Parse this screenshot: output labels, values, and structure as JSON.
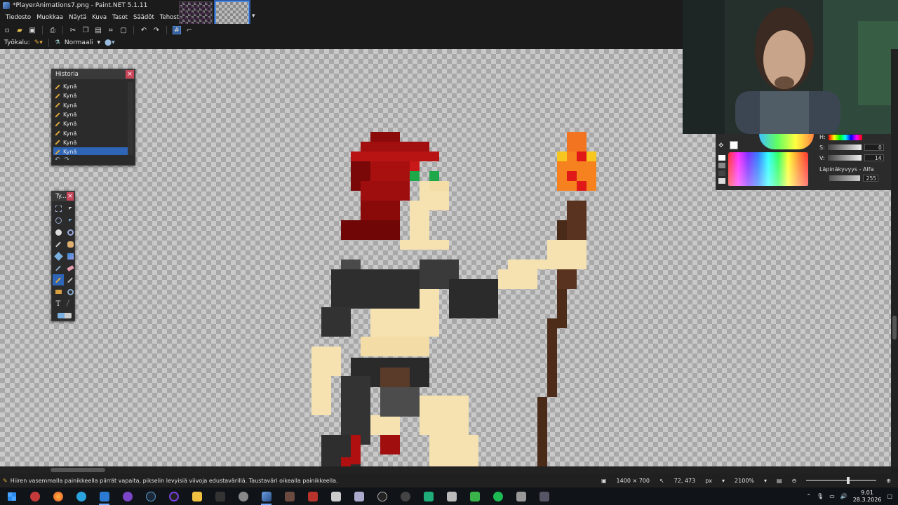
{
  "window": {
    "title": "*PlayerAnimations7.png - Paint.NET 5.1.11"
  },
  "menu": [
    "Tiedosto",
    "Muokkaa",
    "Näytä",
    "Kuva",
    "Tasot",
    "Säädöt",
    "Tehosteet"
  ],
  "tool_options": {
    "tool_label": "Työkalu:",
    "blend_mode": "Normaali"
  },
  "history": {
    "title": "Historia",
    "items": [
      "Kynä",
      "Kynä",
      "Kynä",
      "Kynä",
      "Kynä",
      "Kynä",
      "Kynä",
      "Kynä"
    ],
    "selected_index": 7
  },
  "tools_panel": {
    "title": "Ty..."
  },
  "colors": {
    "h_label": "H:",
    "s_label": "S:",
    "v_label": "V:",
    "s_value": "0",
    "v_value": "14",
    "alpha_label": "Läpinäkyvyys - Alfa",
    "alpha_value": "255",
    "primary": "#1a1a1a"
  },
  "status": {
    "hint": "Hiiren vasemmalla painikkeella piirrät vapaita, pikselin levyisiä viivoja edustavärillä. Taustaväri oikealla painikkeella.",
    "image_size": "1400 × 700",
    "cursor_pos": "72, 473",
    "unit": "px",
    "zoom": "2100%"
  },
  "clock": {
    "time": "9.01",
    "date": "28.3.2026"
  },
  "accent": "#2f65b7"
}
